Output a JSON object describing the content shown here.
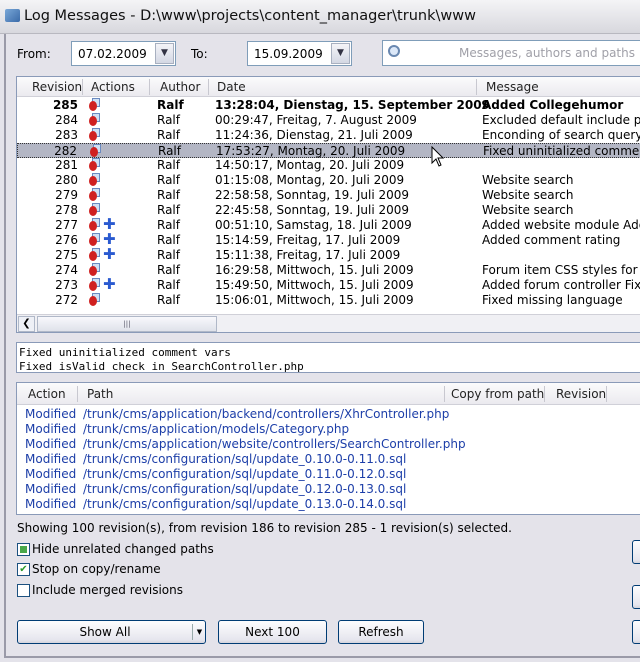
{
  "window": {
    "title": "Log Messages - D:\\www\\projects\\content_manager\\trunk\\www"
  },
  "filter": {
    "from_label": "From:",
    "from_value": "07.02.2009",
    "to_label": "To:",
    "to_value": "15.09.2009",
    "search_placeholder": "Messages, authors and paths"
  },
  "log": {
    "columns": [
      "Revision",
      "Actions",
      "Author",
      "Date",
      "Message"
    ],
    "rows": [
      {
        "revision": "285",
        "actions": [
          "modified"
        ],
        "author": "Ralf",
        "date": "13:28:04, Dienstag, 15. September 2009",
        "message": "Added Collegehumor",
        "bold": true
      },
      {
        "revision": "284",
        "actions": [
          "modified"
        ],
        "author": "Ralf",
        "date": "00:29:47, Freitag, 7. August 2009",
        "message": "Excluded default include path"
      },
      {
        "revision": "283",
        "actions": [
          "modified"
        ],
        "author": "Ralf",
        "date": "11:24:36, Dienstag, 21. Juli 2009",
        "message": "Enconding of search query pl"
      },
      {
        "revision": "282",
        "actions": [
          "modified"
        ],
        "author": "Ralf",
        "date": "17:53:27, Montag, 20. Juli 2009",
        "message": "Fixed uninitialized comment v",
        "selected": true
      },
      {
        "revision": "281",
        "actions": [
          "modified"
        ],
        "author": "Ralf",
        "date": "14:50:17, Montag, 20. Juli 2009",
        "message": ""
      },
      {
        "revision": "280",
        "actions": [
          "modified"
        ],
        "author": "Ralf",
        "date": "01:15:08, Montag, 20. Juli 2009",
        "message": "Website search"
      },
      {
        "revision": "279",
        "actions": [
          "modified"
        ],
        "author": "Ralf",
        "date": "22:58:58, Sonntag, 19. Juli 2009",
        "message": "Website search"
      },
      {
        "revision": "278",
        "actions": [
          "modified"
        ],
        "author": "Ralf",
        "date": "22:45:58, Sonntag, 19. Juli 2009",
        "message": "Website search"
      },
      {
        "revision": "277",
        "actions": [
          "modified",
          "added"
        ],
        "author": "Ralf",
        "date": "00:51:10, Samstag, 18. Juli 2009",
        "message": "Added website module Adde"
      },
      {
        "revision": "276",
        "actions": [
          "modified",
          "added"
        ],
        "author": "Ralf",
        "date": "15:14:59, Freitag, 17. Juli 2009",
        "message": "Added comment rating"
      },
      {
        "revision": "275",
        "actions": [
          "modified",
          "added"
        ],
        "author": "Ralf",
        "date": "15:11:38, Freitag, 17. Juli 2009",
        "message": ""
      },
      {
        "revision": "274",
        "actions": [
          "modified"
        ],
        "author": "Ralf",
        "date": "16:29:58, Mittwoch, 15. Juli 2009",
        "message": "Forum item CSS styles for for"
      },
      {
        "revision": "273",
        "actions": [
          "modified",
          "added"
        ],
        "author": "Ralf",
        "date": "15:49:50, Mittwoch, 15. Juli 2009",
        "message": "Added forum controller Fixed"
      },
      {
        "revision": "272",
        "actions": [
          "modified"
        ],
        "author": "Ralf",
        "date": "15:06:01, Mittwoch, 15. Juli 2009",
        "message": "Fixed missing language"
      }
    ]
  },
  "message_box": {
    "lines": [
      "Fixed uninitialized comment vars",
      "Fixed isValid check in SearchController.php"
    ]
  },
  "paths": {
    "columns": [
      "Action",
      "Path",
      "Copy from path",
      "Revision"
    ],
    "rows": [
      {
        "action": "Modified",
        "path": "/trunk/cms/application/backend/controllers/XhrController.php"
      },
      {
        "action": "Modified",
        "path": "/trunk/cms/application/models/Category.php"
      },
      {
        "action": "Modified",
        "path": "/trunk/cms/application/website/controllers/SearchController.php"
      },
      {
        "action": "Modified",
        "path": "/trunk/cms/configuration/sql/update_0.10.0-0.11.0.sql"
      },
      {
        "action": "Modified",
        "path": "/trunk/cms/configuration/sql/update_0.11.0-0.12.0.sql"
      },
      {
        "action": "Modified",
        "path": "/trunk/cms/configuration/sql/update_0.12.0-0.13.0.sql"
      },
      {
        "action": "Modified",
        "path": "/trunk/cms/configuration/sql/update_0.13.0-0.14.0.sql"
      }
    ]
  },
  "status": "Showing 100 revision(s), from revision 186 to revision 285 - 1 revision(s) selected.",
  "options": [
    {
      "label": "Hide unrelated changed paths",
      "state": "indeterminate"
    },
    {
      "label": "Stop on copy/rename",
      "state": "checked"
    },
    {
      "label": "Include merged revisions",
      "state": "unchecked"
    }
  ],
  "buttons": {
    "show_all": "Show All",
    "next": "Next 100",
    "refresh": "Refresh"
  }
}
